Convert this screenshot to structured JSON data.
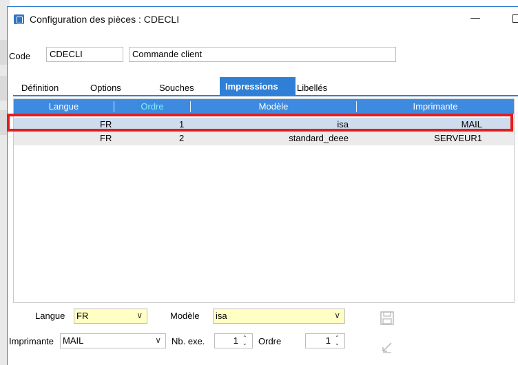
{
  "window": {
    "title": "Configuration des pièces : CDECLI"
  },
  "header_fields": {
    "code_label": "Code",
    "code_value": "CDECLI",
    "description_value": "Commande client"
  },
  "tabs": [
    {
      "label": "Définition",
      "active": false
    },
    {
      "label": "Options",
      "active": false
    },
    {
      "label": "Souches",
      "active": false
    },
    {
      "label": "Impressions",
      "active": true
    },
    {
      "label": "Libellés",
      "active": false
    }
  ],
  "grid": {
    "columns": [
      "Langue",
      "Ordre",
      "Modèle",
      "Imprimante"
    ],
    "rows": [
      {
        "langue": "FR",
        "ordre": "1",
        "modele": "isa",
        "imprimante": "MAIL",
        "selected": true
      },
      {
        "langue": "FR",
        "ordre": "2",
        "modele": "standard_deee",
        "imprimante": "SERVEUR1",
        "selected": false
      }
    ]
  },
  "form": {
    "langue_label": "Langue",
    "langue_value": "FR",
    "modele_label": "Modèle",
    "modele_value": "isa",
    "imprimante_label": "Imprimante",
    "imprimante_value": "MAIL",
    "nb_exe_label": "Nb. exe.",
    "nb_exe_value": "1",
    "ordre_label": "Ordre",
    "ordre_value": "1"
  },
  "icons": {
    "save": "save-icon",
    "undo": "undo-icon",
    "app": "app-icon"
  },
  "colors": {
    "accent": "#2f7fd6",
    "header_bg": "#3d8ae0",
    "ordre_header_text": "#7ff0ff",
    "selected_row": "#cfdcee",
    "highlight_border": "#e41c1c",
    "required_field": "#ffffc4"
  }
}
